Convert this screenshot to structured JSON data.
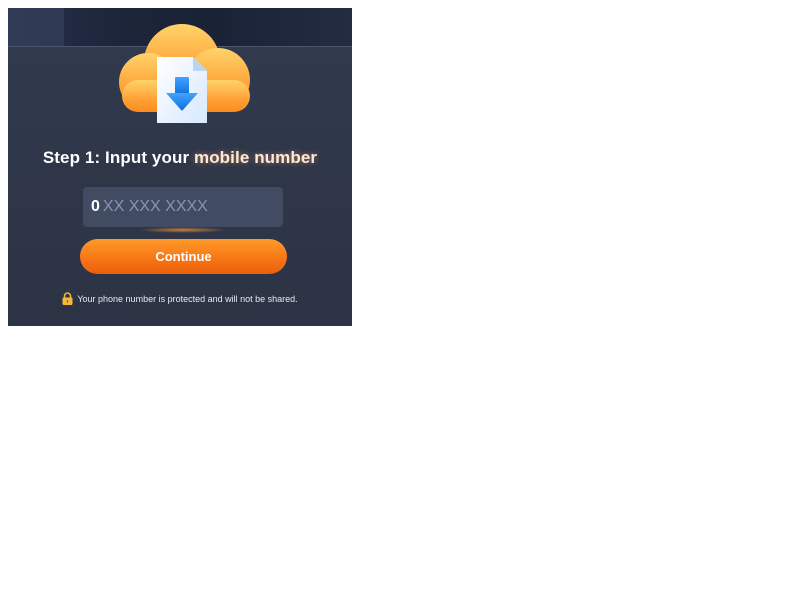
{
  "title": {
    "prefix": "Step 1: Input your ",
    "highlight": "mobile number"
  },
  "phone": {
    "prefix": "0",
    "placeholder": "XX XXX XXXX",
    "value": ""
  },
  "continue_button": {
    "label": "Continue"
  },
  "privacy_note": {
    "text": "Your phone number is protected and will not be shared.",
    "icon": "lock-icon"
  },
  "hero": {
    "icon": "cloud-download-icon"
  },
  "colors": {
    "accent": "#f77716",
    "panel_bg": "#2e3648",
    "field_bg": "#414b62",
    "placeholder": "#8a95ad",
    "highlight_text": "#fde9d6"
  }
}
